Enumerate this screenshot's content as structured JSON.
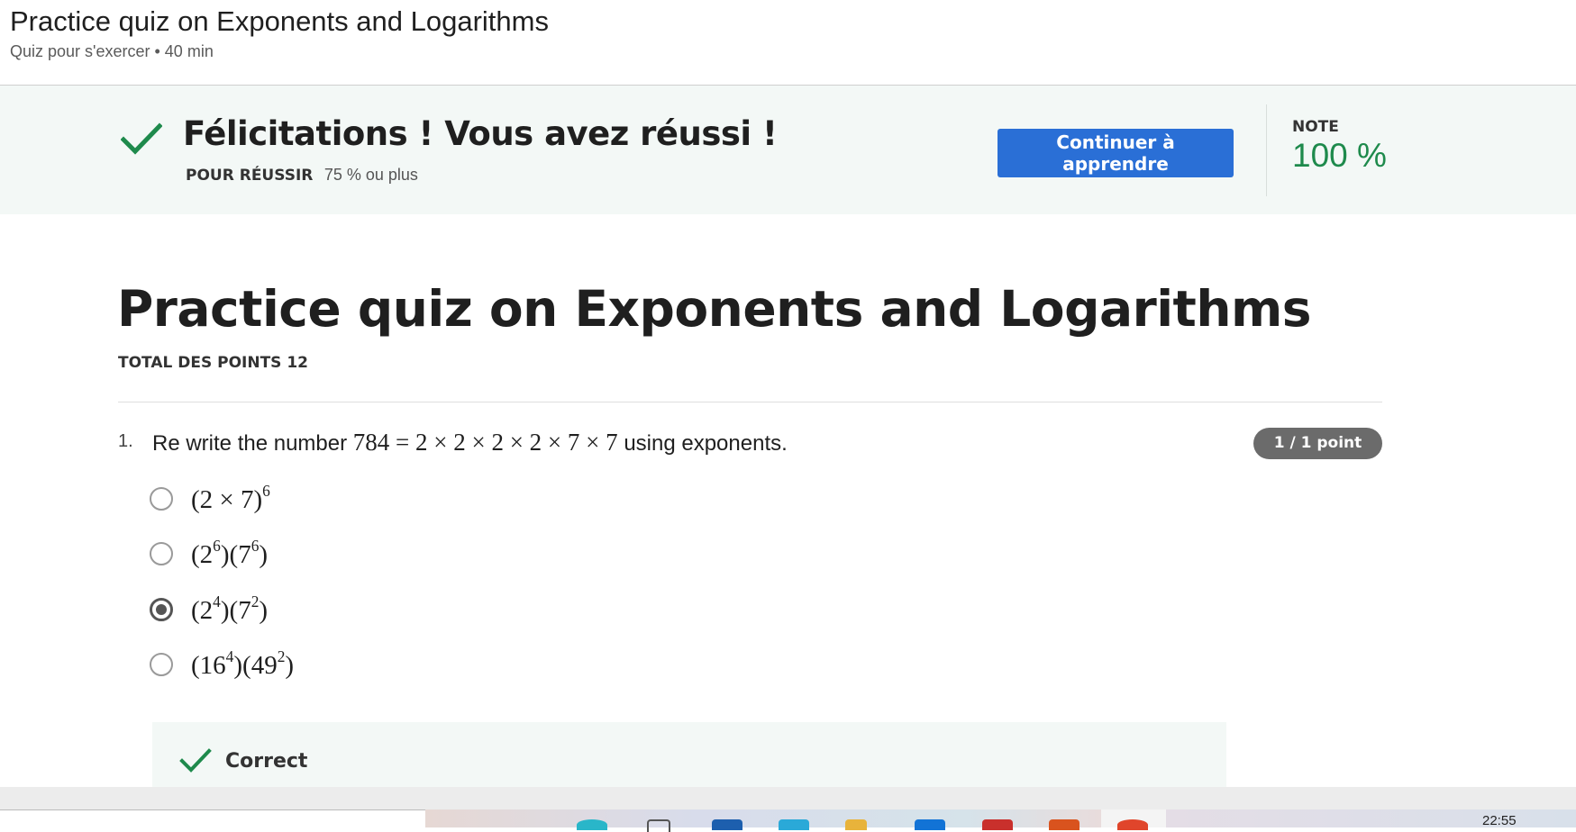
{
  "header": {
    "title": "Practice quiz on Exponents and Logarithms",
    "subtitle": "Quiz pour s'exercer • 40 min"
  },
  "banner": {
    "heading": "Félicitations ! Vous avez réussi !",
    "pass_label": "POUR RÉUSSIR",
    "pass_value": "75 % ou plus",
    "continue_label": "Continuer à apprendre",
    "grade_label": "NOTE",
    "grade_value": "100 %",
    "accent_color": "#1e8a4c",
    "button_color": "#2a6fd6"
  },
  "quiz": {
    "title": "Practice quiz on Exponents and Logarithms",
    "total_points": "TOTAL DES POINTS 12",
    "questions": [
      {
        "number": "1.",
        "text_before": "Re write the number",
        "math": "784 = 2 × 2 × 2 × 2 × 7 × 7",
        "text_after": "using exponents.",
        "points": "1 / 1 point",
        "options": [
          {
            "base": "(2 × 7)",
            "exp": "6",
            "selected": false
          },
          {
            "a": "2",
            "a_exp": "6",
            "b": "7",
            "b_exp": "6",
            "selected": false
          },
          {
            "a": "2",
            "a_exp": "4",
            "b": "7",
            "b_exp": "2",
            "selected": true
          },
          {
            "a": "16",
            "a_exp": "4",
            "b": "49",
            "b_exp": "2",
            "selected": false
          }
        ],
        "feedback": "Correct"
      }
    ]
  },
  "taskbar": {
    "clock": "22:55"
  }
}
